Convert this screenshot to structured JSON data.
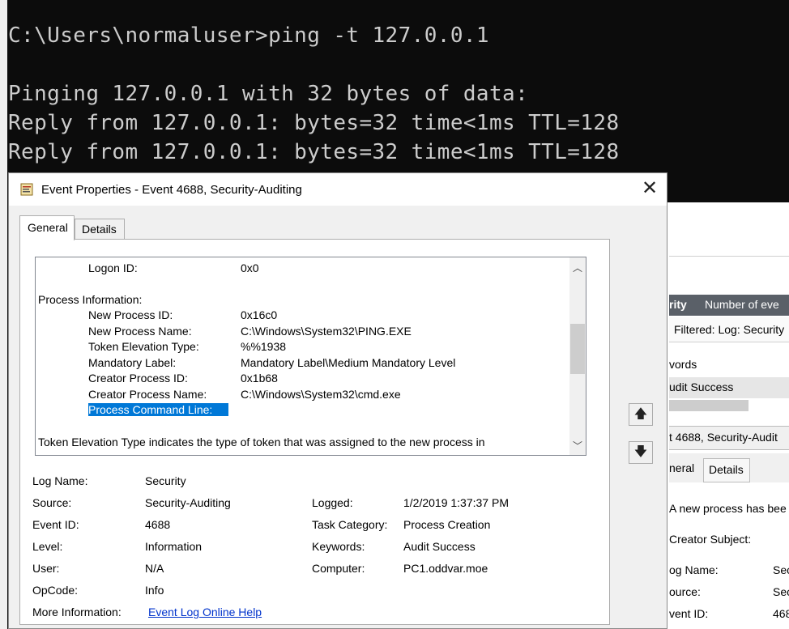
{
  "console": {
    "lines": [
      "C:\\Users\\normaluser>ping -t 127.0.0.1",
      "Pinging 127.0.0.1 with 32 bytes of data:",
      "Reply from 127.0.0.1: bytes=32 time<1ms TTL=128",
      "Reply from 127.0.0.1: bytes=32 time<1ms TTL=128"
    ]
  },
  "dialog": {
    "title": "Event Properties - Event 4688, Security-Auditing",
    "close_glyph": "✕",
    "tabs": [
      "General",
      "Details"
    ],
    "description": {
      "logon_id_label": "Logon ID:",
      "logon_id_value": "0x0",
      "section_title": "Process Information:",
      "fields": [
        {
          "label": "New Process ID:",
          "value": "0x16c0"
        },
        {
          "label": "New Process Name:",
          "value": "C:\\Windows\\System32\\PING.EXE"
        },
        {
          "label": "Token Elevation Type:",
          "value": "%%1938"
        },
        {
          "label": "Mandatory Label:",
          "value": "Mandatory Label\\Medium Mandatory Level"
        },
        {
          "label": "Creator Process ID:",
          "value": "0x1b68"
        },
        {
          "label": "Creator Process Name:",
          "value": "C:\\Windows\\System32\\cmd.exe"
        }
      ],
      "selected_line": "Process Command Line:",
      "footer_text": "Token Elevation Type indicates the type of token that was assigned to the new process in"
    },
    "details": {
      "log_name_label": "Log Name:",
      "log_name": "Security",
      "source_label": "Source:",
      "source": "Security-Auditing",
      "logged_label": "Logged:",
      "logged": "1/2/2019 1:37:37 PM",
      "event_id_label": "Event ID:",
      "event_id": "4688",
      "task_category_label": "Task Category:",
      "task_category": "Process Creation",
      "level_label": "Level:",
      "level": "Information",
      "keywords_label": "Keywords:",
      "keywords": "Audit Success",
      "user_label": "User:",
      "user": "N/A",
      "computer_label": "Computer:",
      "computer": "PC1.oddvar.moe",
      "opcode_label": "OpCode:",
      "opcode": "Info",
      "more_info_label": "More Information:",
      "more_info_link": "Event Log Online Help"
    },
    "nav": {
      "up_glyph": "🡅",
      "down_glyph": "🡇"
    }
  },
  "background_viewer": {
    "header_left": "rity",
    "header_right": "Number of eve",
    "filter": "Filtered: Log: Security",
    "row_keywords": "vords",
    "row_audit": "udit Success",
    "event_title": "t 4688, Security-Audit",
    "tab_general": "neral",
    "tab_details": "Details",
    "desc": "A new process has bee",
    "creator": "Creator Subject:",
    "log_name": "og Name:",
    "log_name_val": "Sec",
    "source": "ource:",
    "source_val": "Sec",
    "event_id": "vent ID:",
    "event_id_val": "468"
  }
}
